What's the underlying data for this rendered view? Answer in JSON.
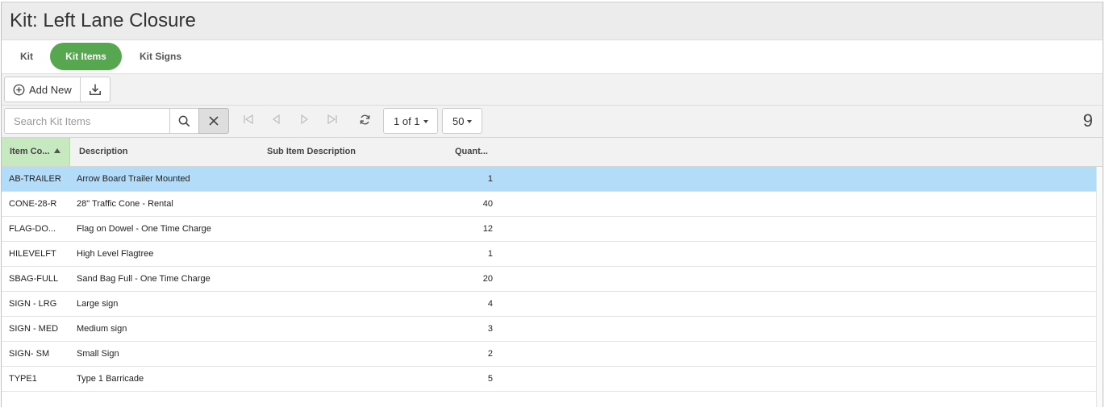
{
  "page": {
    "title": "Kit: Left Lane Closure"
  },
  "tabs": [
    {
      "label": "Kit",
      "active": false
    },
    {
      "label": "Kit Items",
      "active": true
    },
    {
      "label": "Kit Signs",
      "active": false
    }
  ],
  "toolbar": {
    "add_new_label": "Add New"
  },
  "pager": {
    "search_placeholder": "Search Kit Items",
    "search_value": "",
    "page_label": "1 of 1",
    "page_size": "50",
    "total_count": "9"
  },
  "grid": {
    "columns": [
      "Item Co...",
      "Description",
      "Sub Item Description",
      "Quant..."
    ],
    "sort": {
      "column": "Item Co...",
      "direction": "asc"
    },
    "selected_row": 0,
    "rows": [
      {
        "code": "AB-TRAILER",
        "description": "Arrow Board Trailer Mounted",
        "sub": "",
        "qty": "1"
      },
      {
        "code": "CONE-28-R",
        "description": "28\" Traffic Cone - Rental",
        "sub": "",
        "qty": "40"
      },
      {
        "code": "FLAG-DO...",
        "description": "Flag on Dowel - One Time Charge",
        "sub": "",
        "qty": "12"
      },
      {
        "code": "HILEVELFT",
        "description": "High Level Flagtree",
        "sub": "",
        "qty": "1"
      },
      {
        "code": "SBAG-FULL",
        "description": "Sand Bag Full - One Time Charge",
        "sub": "",
        "qty": "20"
      },
      {
        "code": "SIGN - LRG",
        "description": "Large sign",
        "sub": "",
        "qty": "4"
      },
      {
        "code": "SIGN - MED",
        "description": "Medium sign",
        "sub": "",
        "qty": "3"
      },
      {
        "code": "SIGN- SM",
        "description": "Small Sign",
        "sub": "",
        "qty": "2"
      },
      {
        "code": "TYPE1",
        "description": "Type 1 Barricade",
        "sub": "",
        "qty": "5"
      }
    ]
  },
  "colors": {
    "accent": "#56a74f",
    "selected_row": "#b3dcf9",
    "sorted_header": "#c6e9bf"
  },
  "icons": [
    "plus-circle-icon",
    "download-icon",
    "search-icon",
    "close-icon",
    "first-page-icon",
    "prev-page-icon",
    "next-page-icon",
    "last-page-icon",
    "refresh-icon"
  ]
}
